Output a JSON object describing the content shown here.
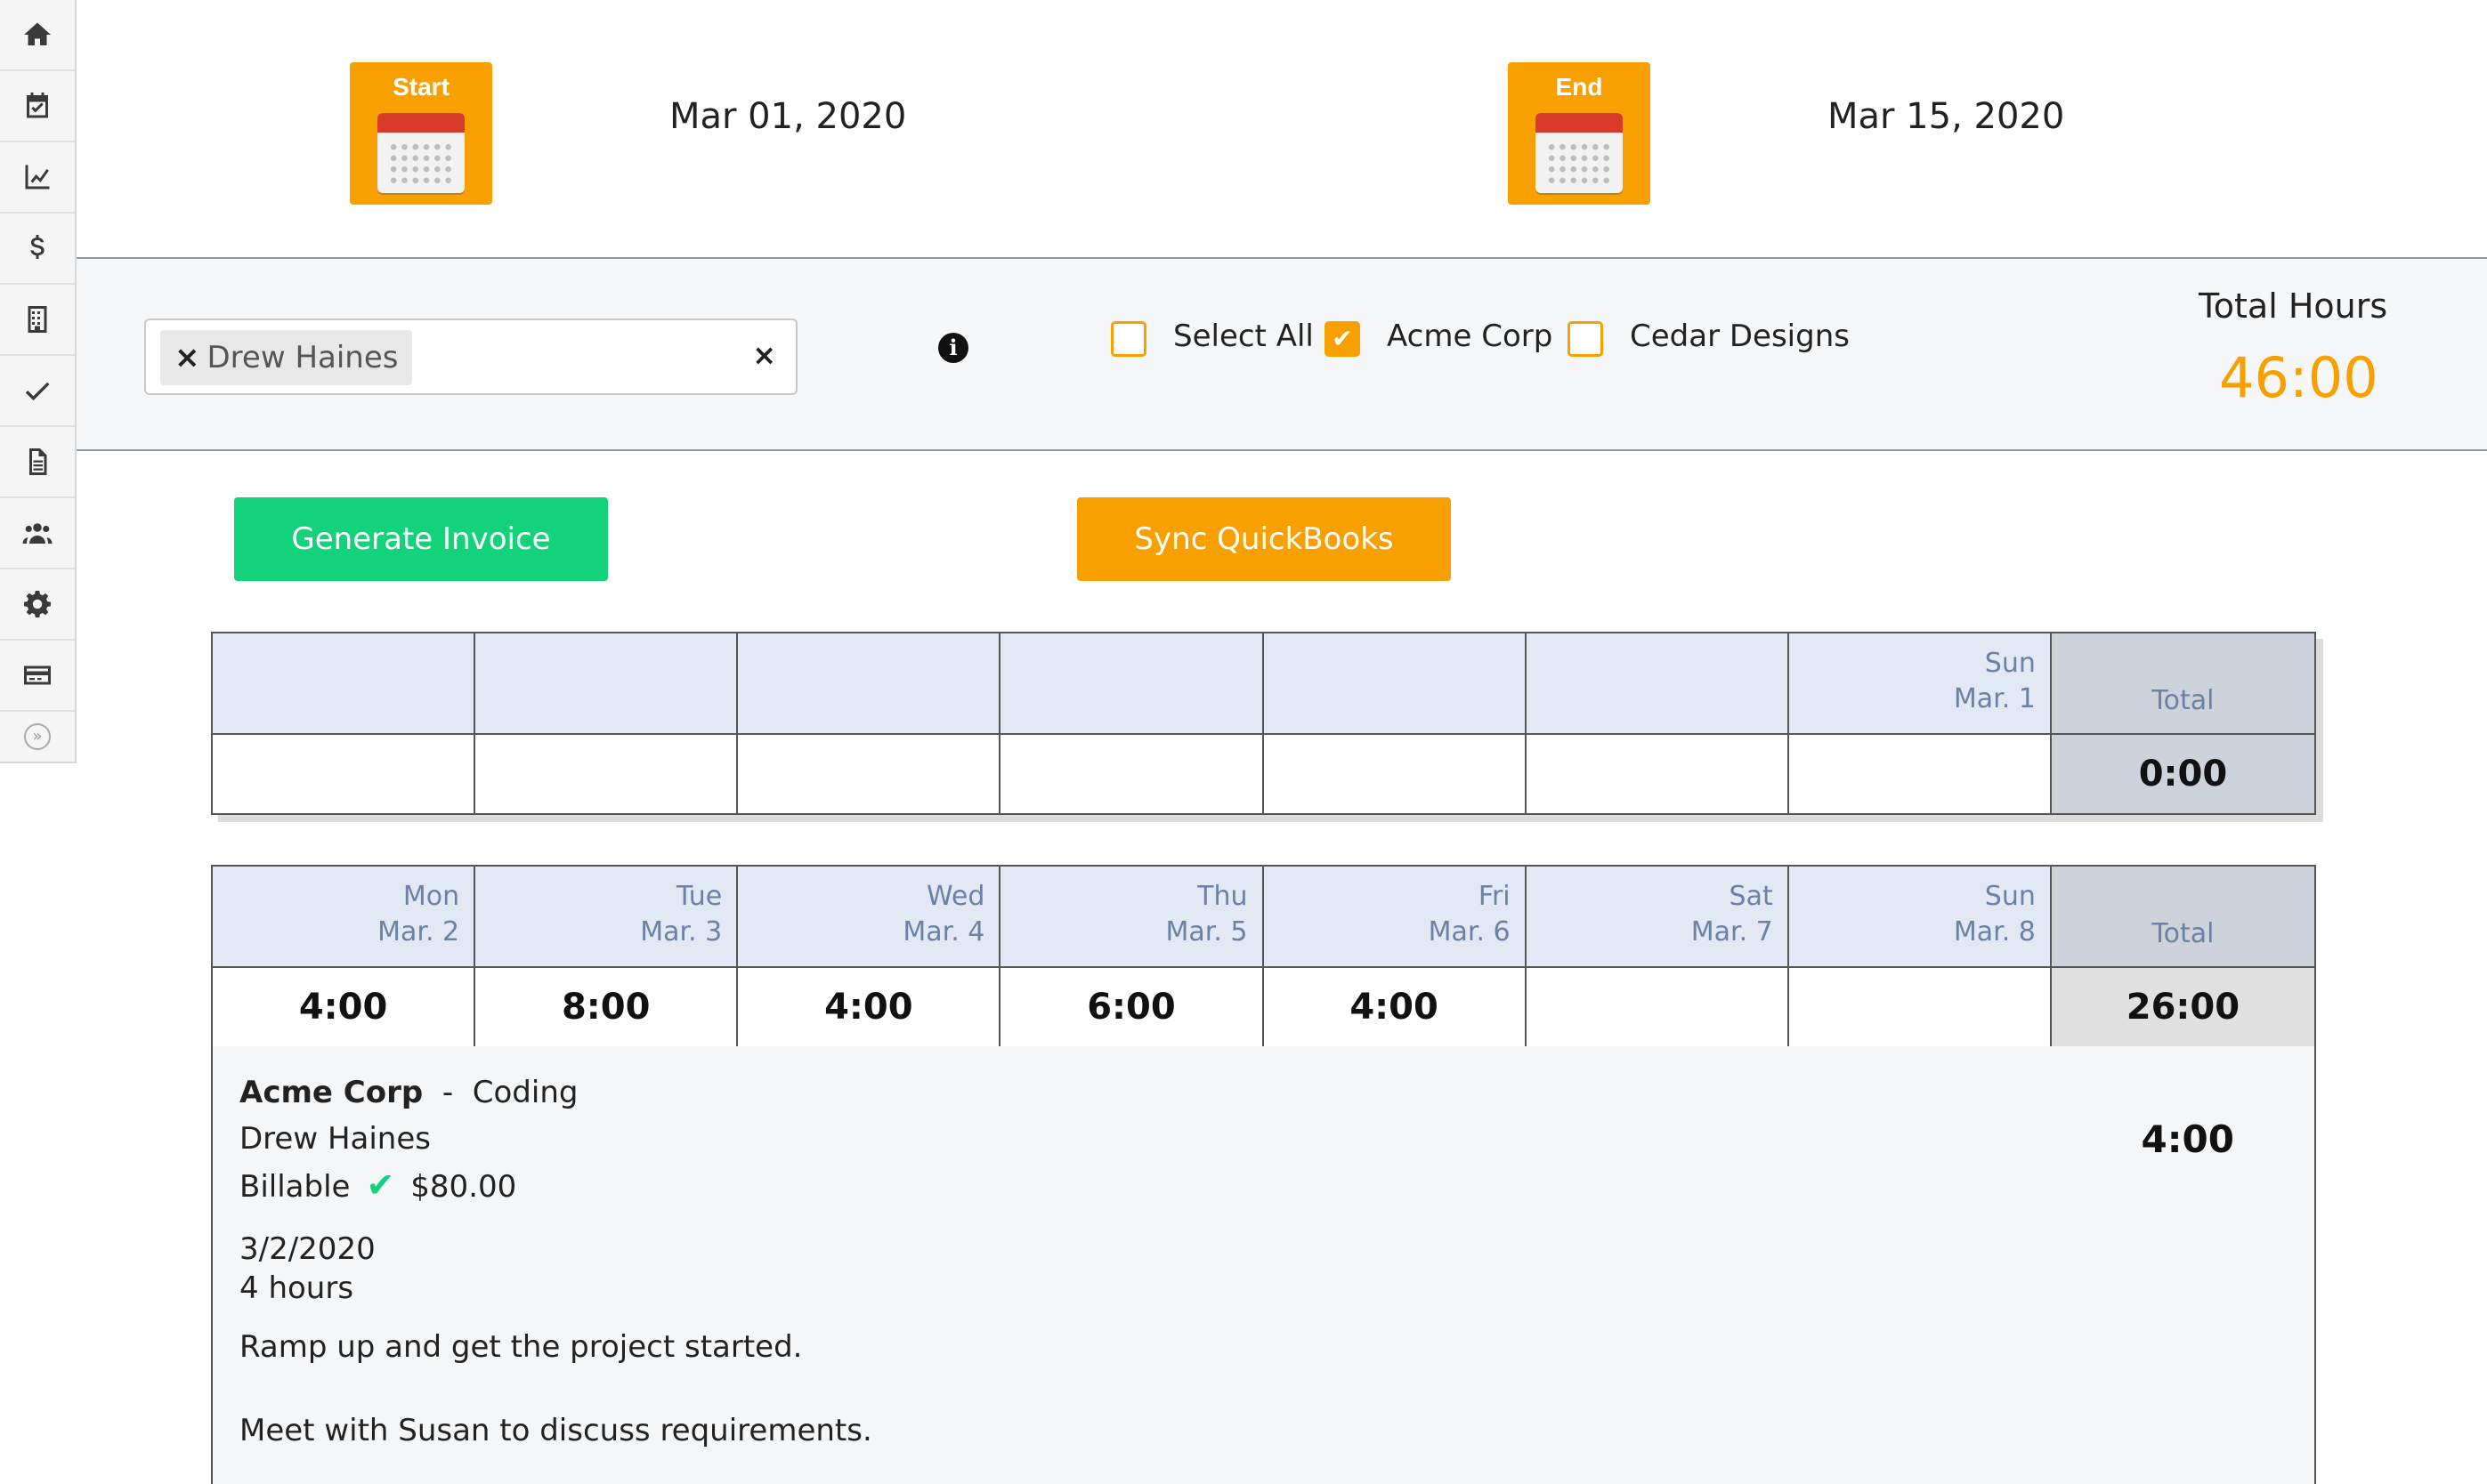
{
  "sidebar": {
    "icons": [
      "home-icon",
      "calendar-check-icon",
      "chart-line-icon",
      "dollar-icon",
      "building-icon",
      "check-icon",
      "document-icon",
      "users-icon",
      "gear-icon",
      "credit-card-icon"
    ],
    "toggle": "»"
  },
  "dates": {
    "start_label": "Start",
    "start_value": "Mar 01, 2020",
    "end_label": "End",
    "end_value": "Mar 15, 2020"
  },
  "filters": {
    "selected_user": "Drew Haines",
    "clear_symbol": "×",
    "remove_symbol": "×",
    "info_symbol": "i",
    "checkboxes": [
      {
        "label": "Select All",
        "checked": false
      },
      {
        "label": "Acme Corp",
        "checked": true
      },
      {
        "label": "Cedar Designs",
        "checked": false
      }
    ],
    "check_mark": "✔",
    "total_hours_label": "Total Hours",
    "total_hours_value": "46:00"
  },
  "actions": {
    "generate_invoice": "Generate Invoice",
    "sync_quickbooks": "Sync QuickBooks"
  },
  "weeks": [
    {
      "headers": [
        {
          "day": "",
          "date": ""
        },
        {
          "day": "",
          "date": ""
        },
        {
          "day": "",
          "date": ""
        },
        {
          "day": "",
          "date": ""
        },
        {
          "day": "",
          "date": ""
        },
        {
          "day": "",
          "date": ""
        },
        {
          "day": "Sun",
          "date": "Mar. 1"
        }
      ],
      "values": [
        "",
        "",
        "",
        "",
        "",
        "",
        ""
      ],
      "total_label": "Total",
      "total_value": "0:00"
    },
    {
      "headers": [
        {
          "day": "Mon",
          "date": "Mar. 2"
        },
        {
          "day": "Tue",
          "date": "Mar. 3"
        },
        {
          "day": "Wed",
          "date": "Mar. 4"
        },
        {
          "day": "Thu",
          "date": "Mar. 5"
        },
        {
          "day": "Fri",
          "date": "Mar. 6"
        },
        {
          "day": "Sat",
          "date": "Mar. 7"
        },
        {
          "day": "Sun",
          "date": "Mar. 8"
        }
      ],
      "values": [
        "4:00",
        "8:00",
        "4:00",
        "6:00",
        "4:00",
        "",
        ""
      ],
      "total_label": "Total",
      "total_value": "26:00"
    }
  ],
  "entry": {
    "client": "Acme Corp",
    "separator": "-",
    "task": "Coding",
    "user": "Drew Haines",
    "billable_label": "Billable",
    "billable_check": "✔",
    "amount": "$80.00",
    "hours": "4:00",
    "date": "3/2/2020",
    "duration": "4 hours",
    "description_1": "Ramp up and get the project started.",
    "description_2": "Meet with Susan to discuss requirements."
  },
  "colors": {
    "accent_orange": "#f7a000",
    "accent_green": "#12d27a",
    "header_blue": "#e2e8f4",
    "header_text": "#6b82a6"
  }
}
